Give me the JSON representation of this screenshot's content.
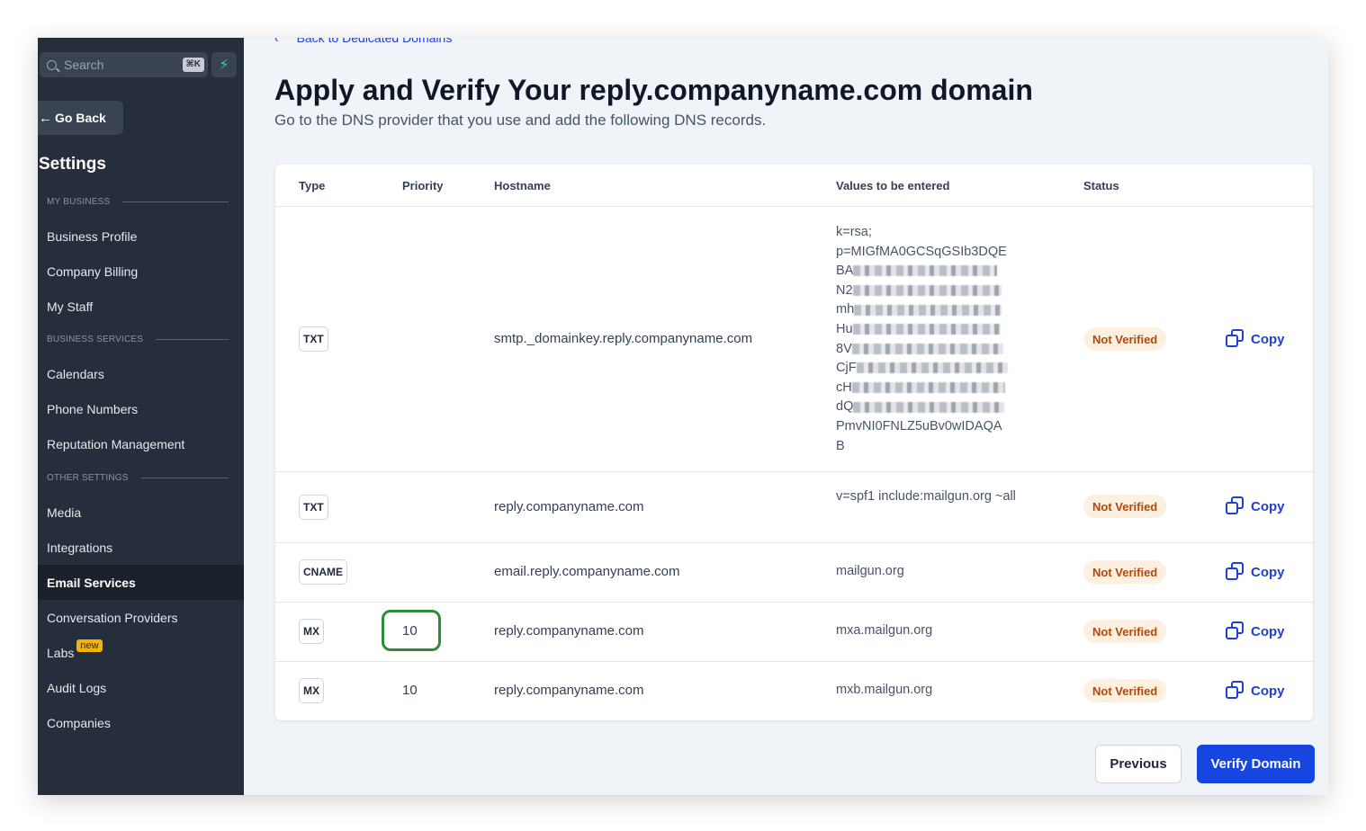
{
  "sidebar": {
    "search_placeholder": "Search",
    "search_shortcut": "⌘K",
    "go_back": "Go Back",
    "title": "Settings",
    "sections": {
      "my_business": "MY BUSINESS",
      "business_services": "BUSINESS SERVICES",
      "other_settings": "OTHER SETTINGS"
    },
    "items": {
      "business_profile": "Business Profile",
      "company_billing": "Company Billing",
      "my_staff": "My Staff",
      "calendars": "Calendars",
      "phone_numbers": "Phone Numbers",
      "reputation_management": "Reputation Management",
      "media": "Media",
      "integrations": "Integrations",
      "email_services": "Email Services",
      "conversation_providers": "Conversation Providers",
      "labs": "Labs",
      "labs_badge": "new",
      "audit_logs": "Audit Logs",
      "companies": "Companies"
    },
    "active_item": "Email Services"
  },
  "main": {
    "back_link": "Back to Dedicated Domains",
    "title": "Apply and Verify Your reply.companyname.com domain",
    "subtitle": "Go to the DNS provider that you use and add the following DNS records.",
    "columns": {
      "type": "Type",
      "priority": "Priority",
      "hostname": "Hostname",
      "values": "Values to be entered",
      "status": "Status"
    },
    "rows": [
      {
        "type": "TXT",
        "priority": "",
        "hostname": "smtp._domainkey.reply.companyname.com",
        "value_lines": [
          "k=rsa;",
          "p=MIGfMA0GCSqGSIb3DQE",
          "BA",
          "N2",
          "mh",
          "Hu",
          "8V",
          "CjF",
          "cH",
          "dQ",
          "PmvNI0FNLZ5uBv0wIDAQA",
          "B"
        ],
        "status": "Not Verified",
        "copy": "Copy"
      },
      {
        "type": "TXT",
        "priority": "",
        "hostname": "reply.companyname.com",
        "value": "v=spf1 include:mailgun.org ~all",
        "status": "Not Verified",
        "copy": "Copy"
      },
      {
        "type": "CNAME",
        "priority": "",
        "hostname": "email.reply.companyname.com",
        "value": "mailgun.org",
        "status": "Not Verified",
        "copy": "Copy"
      },
      {
        "type": "MX",
        "priority": "10",
        "hostname": "reply.companyname.com",
        "value": "mxa.mailgun.org",
        "status": "Not Verified",
        "copy": "Copy"
      },
      {
        "type": "MX",
        "priority": "10",
        "hostname": "reply.companyname.com",
        "value": "mxb.mailgun.org",
        "status": "Not Verified",
        "copy": "Copy"
      }
    ],
    "buttons": {
      "previous": "Previous",
      "verify": "Verify Domain"
    }
  },
  "colors": {
    "sidebar_bg": "#262e3b",
    "accent": "#1745e0",
    "status_bg": "#fdf0e1",
    "status_text": "#b54708",
    "highlight": "#2e8b3a"
  }
}
